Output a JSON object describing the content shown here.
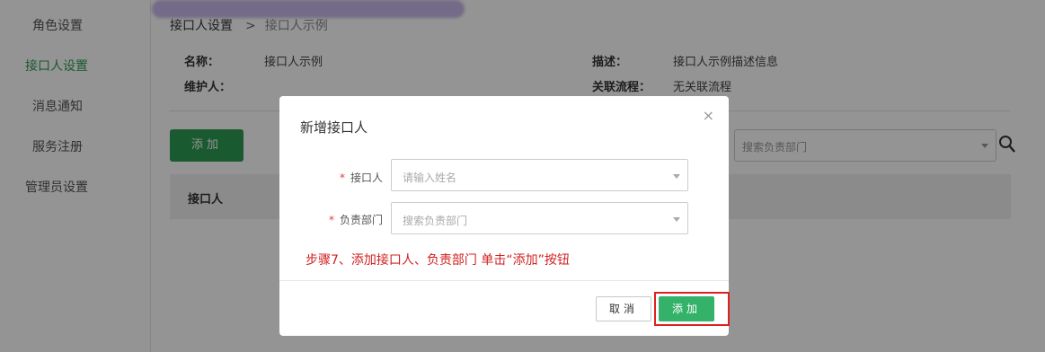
{
  "sidebar": {
    "items": [
      {
        "label": "角色设置",
        "active": false
      },
      {
        "label": "接口人设置",
        "active": true
      },
      {
        "label": "消息通知",
        "active": false
      },
      {
        "label": "服务注册",
        "active": false
      },
      {
        "label": "管理员设置",
        "active": false
      }
    ]
  },
  "breadcrumb": {
    "root": "接口人设置",
    "separator": ">",
    "current": "接口人示例"
  },
  "info": {
    "name_label": "名称：",
    "name_value": "接口人示例",
    "maintainer_label": "维护人：",
    "desc_label": "描述：",
    "desc_value": "接口人示例描述信息",
    "flow_label": "关联流程：",
    "flow_value": "无关联流程"
  },
  "toolbar": {
    "add_label": "添加",
    "dept_search_placeholder": "搜索负责部门"
  },
  "table": {
    "columns": [
      "接口人"
    ]
  },
  "modal": {
    "title": "新增接口人",
    "close_glyph": "×",
    "required_mark": "*",
    "field1_label": "接口人",
    "field1_placeholder": "请输入姓名",
    "field2_label": "负责部门",
    "field2_placeholder": "搜索负责部门",
    "instruction": "步骤7、添加接口人、负责部门 单击“添加”按钮",
    "cancel_label": "取消",
    "confirm_label": "添加"
  },
  "colors": {
    "accent_green": "#2e9b53",
    "confirm_green": "#35b26a",
    "highlight_red": "#e02020",
    "instruction_red": "#d12020"
  }
}
